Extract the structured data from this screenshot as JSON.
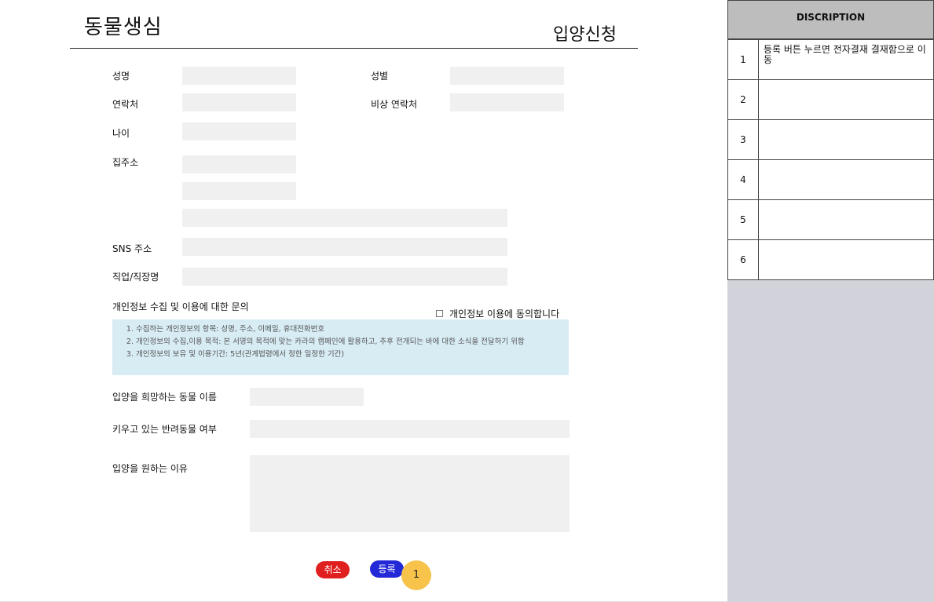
{
  "header": {
    "logo": "동물생심",
    "page_title": "입양신청"
  },
  "form": {
    "name_label": "성명",
    "gender_label": "성별",
    "contact_label": "연락처",
    "emergency_contact_label": "비상 연락처",
    "age_label": "나이",
    "address_label": "집주소",
    "sns_label": "SNS 주소",
    "job_label": "직업/직장명",
    "consent_title": "개인정보 수집 및 이용에 대한 문의",
    "consent_checkbox_label": "개인정보 이용에 동의합니다",
    "notice_items": [
      "수집하는 개인정보의 항목: 성명, 주소, 이메일, 휴대전화번호",
      "개인정보의 수집,이용 목적: 본 서명의 목적에 맞는 카라의 캠페인에 활용하고, 추후 전개되는 바에 대한 소식을 전달하기 위함",
      "개인정보의 보유 및 이용기간: 5년(관계법령에서 정한 일정한 기간)"
    ],
    "desired_animal_label": "입양을 희망하는 동물 이름",
    "current_pet_label": "키우고 있는 반려동물 여부",
    "reason_label": "입양을 원하는 이유"
  },
  "actions": {
    "cancel_label": "취소",
    "submit_label": "등록",
    "marker": "1"
  },
  "description_panel": {
    "title": "DISCRIPTION",
    "rows": [
      {
        "num": "1",
        "text": "등록 버튼 누르면 전자결재 결재함으로 이동"
      },
      {
        "num": "2",
        "text": ""
      },
      {
        "num": "3",
        "text": ""
      },
      {
        "num": "4",
        "text": ""
      },
      {
        "num": "5",
        "text": ""
      },
      {
        "num": "6",
        "text": ""
      }
    ]
  },
  "colors": {
    "cancel": "#e0201f",
    "submit": "#2329d6",
    "marker": "#f7c34b",
    "notice_bg": "#d8ecf4",
    "field_bg": "#f0f0f0",
    "panel_bg": "#d2d2da"
  }
}
